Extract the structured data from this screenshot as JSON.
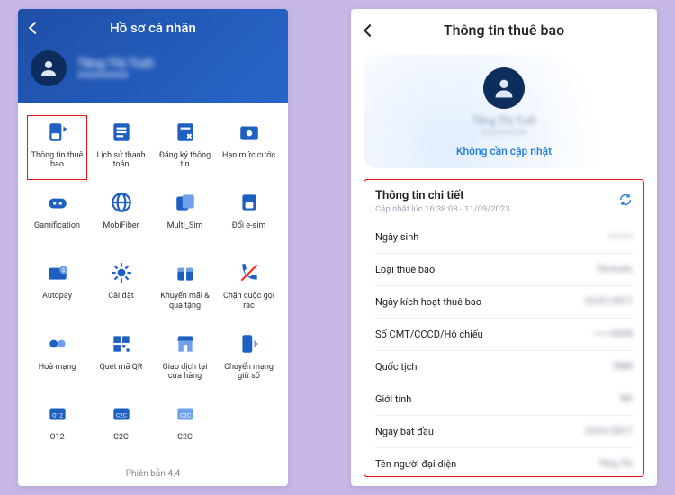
{
  "left": {
    "header_title": "Hồ sơ cá nhân",
    "profile_name": "Tăng Thị Tuổi",
    "profile_sub": "0900000000",
    "version": "Phiên bản 4.4",
    "tiles": [
      {
        "label": "Thông tin thuê bao",
        "icon": "sim-info-icon",
        "hl": true
      },
      {
        "label": "Lịch sử thanh toán",
        "icon": "history-icon"
      },
      {
        "label": "Đăng ký thông tin",
        "icon": "register-icon"
      },
      {
        "label": "Hạn mức cước",
        "icon": "limit-icon"
      },
      {
        "label": "Gamification",
        "icon": "game-icon"
      },
      {
        "label": "MobiFiber",
        "icon": "globe-icon"
      },
      {
        "label": "Multi_Sim",
        "icon": "multi-sim-icon"
      },
      {
        "label": "Đổi e-sim",
        "icon": "esim-icon"
      },
      {
        "label": "Autopay",
        "icon": "autopay-icon"
      },
      {
        "label": "Cài đặt",
        "icon": "settings-icon"
      },
      {
        "label": "Khuyến mãi & quà tặng",
        "icon": "promo-icon"
      },
      {
        "label": "Chặn cuộc gọi rác",
        "icon": "spam-call-icon"
      },
      {
        "label": "Hoà mạng",
        "icon": "network-join-icon"
      },
      {
        "label": "Quét mã QR",
        "icon": "qr-icon"
      },
      {
        "label": "Giao dịch tại cửa hàng",
        "icon": "store-txn-icon"
      },
      {
        "label": "Chuyển mạng giữ số",
        "icon": "mnp-icon"
      },
      {
        "label": "O12",
        "icon": "o12-icon"
      },
      {
        "label": "C2C",
        "icon": "c2c-a-icon"
      },
      {
        "label": "C2C",
        "icon": "c2c-b-icon"
      },
      {
        "label": " ",
        "icon": "blank-icon"
      }
    ]
  },
  "right": {
    "header_title": "Thông tin thuê bao",
    "card": {
      "name": "Tăng Thị Tuổi",
      "sub": "0900000000",
      "status": "Không cần cập nhật"
    },
    "detail_title": "Thông tin chi tiết",
    "detail_ts": "Cập nhật lúc 16:38:08 - 11/09/2023",
    "rows": [
      {
        "label": "Ngày sinh",
        "value": "••••••••"
      },
      {
        "label": "Loại thuê bao",
        "value": "Trả trước"
      },
      {
        "label": "Ngày kích hoạt thuê bao",
        "value": "23/01/2017"
      },
      {
        "label": "Số CMT/CCCD/Hộ chiếu",
        "value": "••••••0235"
      },
      {
        "label": "Quốc tịch",
        "value": "VNM"
      },
      {
        "label": "Giới tính",
        "value": "Nữ"
      },
      {
        "label": "Ngày bắt đầu",
        "value": "23/01/2017"
      },
      {
        "label": "Tên người đại diện",
        "value": "Tăng Thị"
      }
    ]
  }
}
